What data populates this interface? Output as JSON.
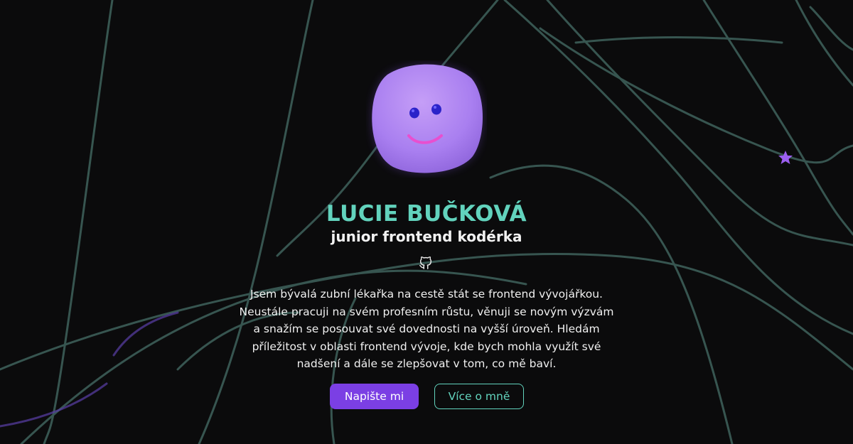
{
  "profile": {
    "name": "LUCIE BUČKOVÁ",
    "role": "junior frontend kodérka",
    "bio_lines": [
      "Jsem bývalá zubní lékařka na cestě stát se frontend vývojářkou.",
      "Neustále pracuji na svém profesním růstu, věnuji se novým výzvám",
      "a snažím se posouvat své dovednosti na vyšší úroveň. Hledám",
      "příležitost v oblasti frontend vývoje, kde bych mohla využít své",
      "nadšení a dále se zlepšovat v tom, co mě baví."
    ]
  },
  "actions": {
    "contact_label": "Napište mi",
    "about_label": "Více o mně"
  },
  "icons": {
    "github": "github-icon",
    "avatar": "smiley-blob-avatar",
    "star": "star-icon"
  },
  "colors": {
    "background": "#0b0b0c",
    "accent_teal": "#62d3bd",
    "accent_purple": "#7b3fe4",
    "text": "#f0f0f0",
    "lines": "#3a5c57"
  }
}
